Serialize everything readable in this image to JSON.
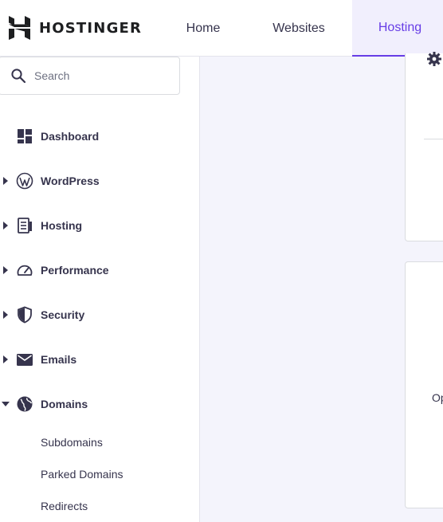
{
  "header": {
    "logo_text": "HOSTINGER",
    "tabs": [
      {
        "label": "Home",
        "active": false
      },
      {
        "label": "Websites",
        "active": false
      },
      {
        "label": "Hosting",
        "active": true
      }
    ]
  },
  "sidebar": {
    "search_placeholder": "Search",
    "items": [
      {
        "label": "Dashboard",
        "icon": "dashboard-icon",
        "expandable": false
      },
      {
        "label": "WordPress",
        "icon": "wordpress-icon",
        "expandable": true
      },
      {
        "label": "Hosting",
        "icon": "server-icon",
        "expandable": true
      },
      {
        "label": "Performance",
        "icon": "speedometer-icon",
        "expandable": true
      },
      {
        "label": "Security",
        "icon": "shield-icon",
        "expandable": true
      },
      {
        "label": "Emails",
        "icon": "envelope-icon",
        "expandable": true
      },
      {
        "label": "Domains",
        "icon": "globe-icon",
        "expandable": true,
        "expanded": true
      }
    ],
    "sub_items": [
      "Subdomains",
      "Parked Domains",
      "Redirects"
    ]
  },
  "main": {
    "cut_text": "Op"
  },
  "colors": {
    "accent": "#673de6",
    "text": "#36344d",
    "background": "#f4f4fc",
    "active_tab_bg": "#f1effd"
  }
}
